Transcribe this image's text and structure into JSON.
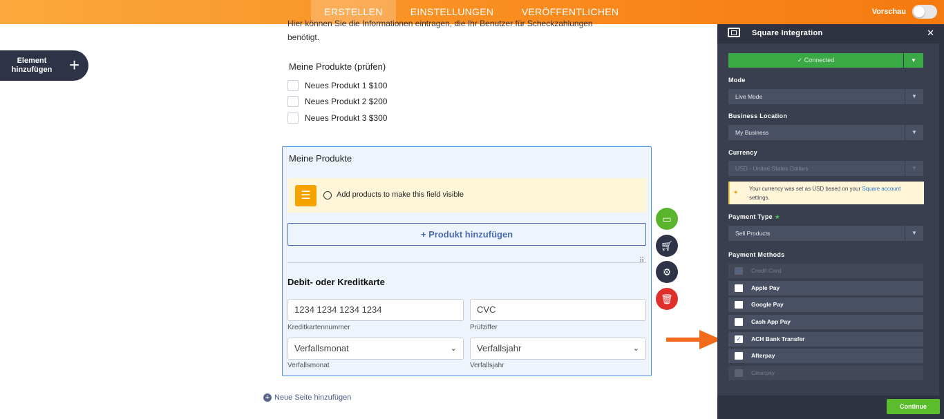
{
  "topbar": {
    "tabs": [
      {
        "label": "ERSTELLEN"
      },
      {
        "label": "EINSTELLUNGEN"
      },
      {
        "label": "VERÖFFENTLICHEN"
      }
    ],
    "preview_label": "Vorschau"
  },
  "add_element": {
    "label": "Element hinzufügen",
    "icon": "plus-icon"
  },
  "form": {
    "intro_text": "Hier können Sie die Informationen eintragen, die Ihr Benutzer für Scheckzahlungen benötigt.",
    "check_title": "Meine Produkte (prüfen)",
    "check_items": [
      "Neues Produkt 1 $100",
      "Neues Produkt 2 $200",
      "Neues Produkt 3 $300"
    ],
    "product_title": "Meine Produkte",
    "notice_text": "Add products to make this field visible",
    "add_product_label": "+ Produkt hinzufügen",
    "payment_title": "Debit- oder Kreditkarte",
    "card_number_placeholder": "1234 1234 1234 1234",
    "card_number_label": "Kreditkartennummer",
    "cvc_placeholder": "CVC",
    "cvc_label": "Prüfziffer",
    "month_value": "Verfallsmonat",
    "month_label": "Verfallsmonat",
    "year_value": "Verfallsjahr",
    "year_label": "Verfallsjahr",
    "new_page_label": "Neue Seite hinzufügen"
  },
  "side_buttons": [
    {
      "icon": "card-icon",
      "color": "#5bb52c"
    },
    {
      "icon": "cart-icon",
      "color": "#2e3347"
    },
    {
      "icon": "gear-icon",
      "color": "#2e3347"
    },
    {
      "icon": "trash-icon",
      "color": "#e0302b"
    }
  ],
  "panel": {
    "title": "Square Integration",
    "connected_label": "✓ Connected",
    "mode_label": "Mode",
    "mode_value": "Live Mode",
    "location_label": "Business Location",
    "location_value": "My Business",
    "currency_label": "Currency",
    "currency_value": "USD - United States Dollars",
    "currency_info_pre": "Your currency was set as USD based on your",
    "currency_info_link": "Square account",
    "currency_info_post": "settings.",
    "payment_type_label": "Payment Type",
    "payment_type_value": "Sell Products",
    "payment_methods_label": "Payment Methods",
    "methods": [
      {
        "label": "Credit Card",
        "checked": true,
        "disabled": true
      },
      {
        "label": "Apple Pay",
        "checked": false,
        "disabled": false
      },
      {
        "label": "Google Pay",
        "checked": false,
        "disabled": false
      },
      {
        "label": "Cash App Pay",
        "checked": false,
        "disabled": false
      },
      {
        "label": "ACH Bank Transfer",
        "checked": true,
        "disabled": false
      },
      {
        "label": "Afterpay",
        "checked": false,
        "disabled": false
      },
      {
        "label": "Clearpay",
        "checked": false,
        "disabled": true
      }
    ],
    "continue_label": "Continue"
  },
  "colors": {
    "accent": "#f98a1d",
    "panel_bg": "#3a3f4f",
    "connected": "#3aa845",
    "arrow": "#f26a1b"
  }
}
